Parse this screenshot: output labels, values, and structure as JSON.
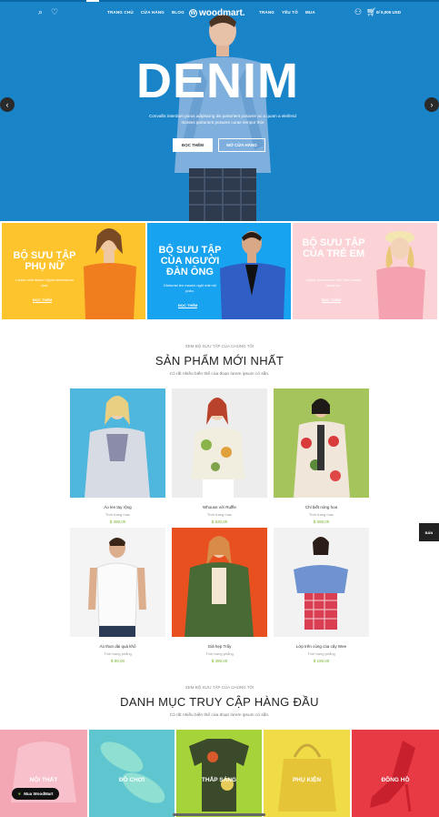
{
  "header": {
    "menu_left": [
      "TRANG CHỦ",
      "CỬA HÀNG",
      "BLOG"
    ],
    "logo": "woodmart.",
    "menu_right": [
      "TRANG",
      "YẾU TỐ",
      "MUA"
    ],
    "cart_price": "0/ 0,000 USD",
    "icons": [
      "search-icon",
      "heart-icon",
      "user-icon",
      "cart-icon"
    ]
  },
  "hero": {
    "title": "DENIM",
    "subtitle": "Convallis interdum purus adipiscing dis parturient posuere ac a quam a eleifend montes parturient posuere curae tempor thời",
    "btn_primary": "ĐỌC THÊM",
    "btn_secondary": "MỞ CỬA HÀNG",
    "bg_color": "#1a84c9"
  },
  "banners": [
    {
      "title": "BỘ SƯU TẬP PHỤ NỮ",
      "desc": "Lorem velit dictum ligula elementum dolo",
      "link": "ĐỌC THÊM",
      "color": "#fec42d"
    },
    {
      "title": "BỘ SƯU TẬP CỦA NGƯỜI ĐÀN ÔNG",
      "desc": "Dictumst leo mauris ngôi mái nói justo.",
      "link": "ĐỌC THÊM",
      "color": "#17a3ef"
    },
    {
      "title": "BỘ SƯU TẬP CỦA TRẺ EM",
      "desc": "Ligula elementum felis felis mauris dictumst.",
      "link": "ĐỌC THÊM",
      "color": "#fbd3d7"
    }
  ],
  "new_products": {
    "kicker": "XEM BỘ SƯU TẬP CỦA CHÚNG TÔI",
    "title": "SẢN PHẨM MỚI NHẤT",
    "desc": "Có rất nhiều biến thể của đoạn lorem ipsum có sẵn.",
    "items": [
      {
        "name": "Áo len tay rộng",
        "category": "Thời trang màu",
        "price": "$ 499,00"
      },
      {
        "name": "Whouse với Ruffle",
        "category": "Thời trang màu",
        "price": "$ 520,00"
      },
      {
        "name": "Chỉ biết nóng hoa",
        "category": "Thời trang màu",
        "price": "$ 599,00"
      },
      {
        "name": "Áo thun dài quá khổ",
        "category": "Thời trang phẳng",
        "price": "$ 99,00"
      },
      {
        "name": "Giả hẹp Trẩy",
        "category": "Thời trang phẳng",
        "price": "$ 499,00"
      },
      {
        "name": "Lớp trên cùng của cây Wee",
        "category": "Thời trang phẳng",
        "price": "$ 199,00"
      }
    ]
  },
  "top_categories": {
    "kicker": "XEM BỘ SƯU TẬP CỦA CHÚNG TÔI",
    "title": "DANH MỤC TRUY CẬP HÀNG ĐẦU",
    "desc": "Có rất nhiều biến thể của đoạn lorem ipsum có sẵn.",
    "items": [
      "NỘI THẤT",
      "ĐỒ CHƠI",
      "THẮP SÁNG",
      "PHỤ KIỆN",
      "ĐỒNG HỒ"
    ]
  },
  "side_chip": "BÁN",
  "buy_chip": "Mua WoodMart"
}
